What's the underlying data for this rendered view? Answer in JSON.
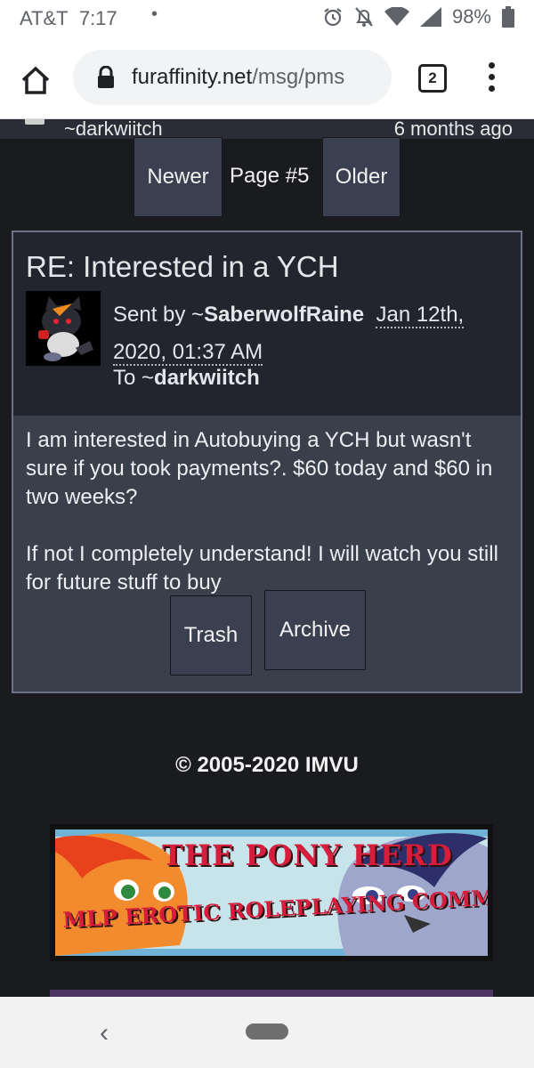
{
  "status_bar": {
    "carrier": "AT&T",
    "time": "7:17",
    "dot": "•",
    "battery": "98%"
  },
  "browser": {
    "url_host": "furaffinity.net",
    "url_path": "/msg/pms",
    "tab_count": "2"
  },
  "previous_row": {
    "user": "~darkwiitch",
    "time_ago": "6 months ago"
  },
  "pager": {
    "newer": "Newer",
    "page": "Page #5",
    "older": "Older"
  },
  "message": {
    "title": "RE: Interested in a YCH",
    "sent_by_label": "Sent by ~",
    "sender": "SaberwolfRaine",
    "date": "Jan 12th, 2020, 01:37 AM",
    "to_label": "To ~",
    "recipient": "darkwiitch",
    "body_p1": "I am interested in Autobuying a YCH but wasn't sure if you took payments?. $60 today and $60 in two weeks?",
    "body_p2": "If not I completely understand! I will watch you still for future stuff to buy",
    "trash": "Trash",
    "archive": "Archive"
  },
  "footer": {
    "copyright": "© 2005-2020 IMVU"
  },
  "banner": {
    "title": "THE PONY HERD",
    "subtitle": "MLP EROTIC ROLEPLAYING COMMUNITY"
  },
  "colors": {
    "page_bg": "#1a1b1f",
    "panel_bg": "#3a3f4c",
    "header_bg": "#22252d",
    "button_bg": "#3a4050",
    "banner_text": "#d61e3c"
  }
}
